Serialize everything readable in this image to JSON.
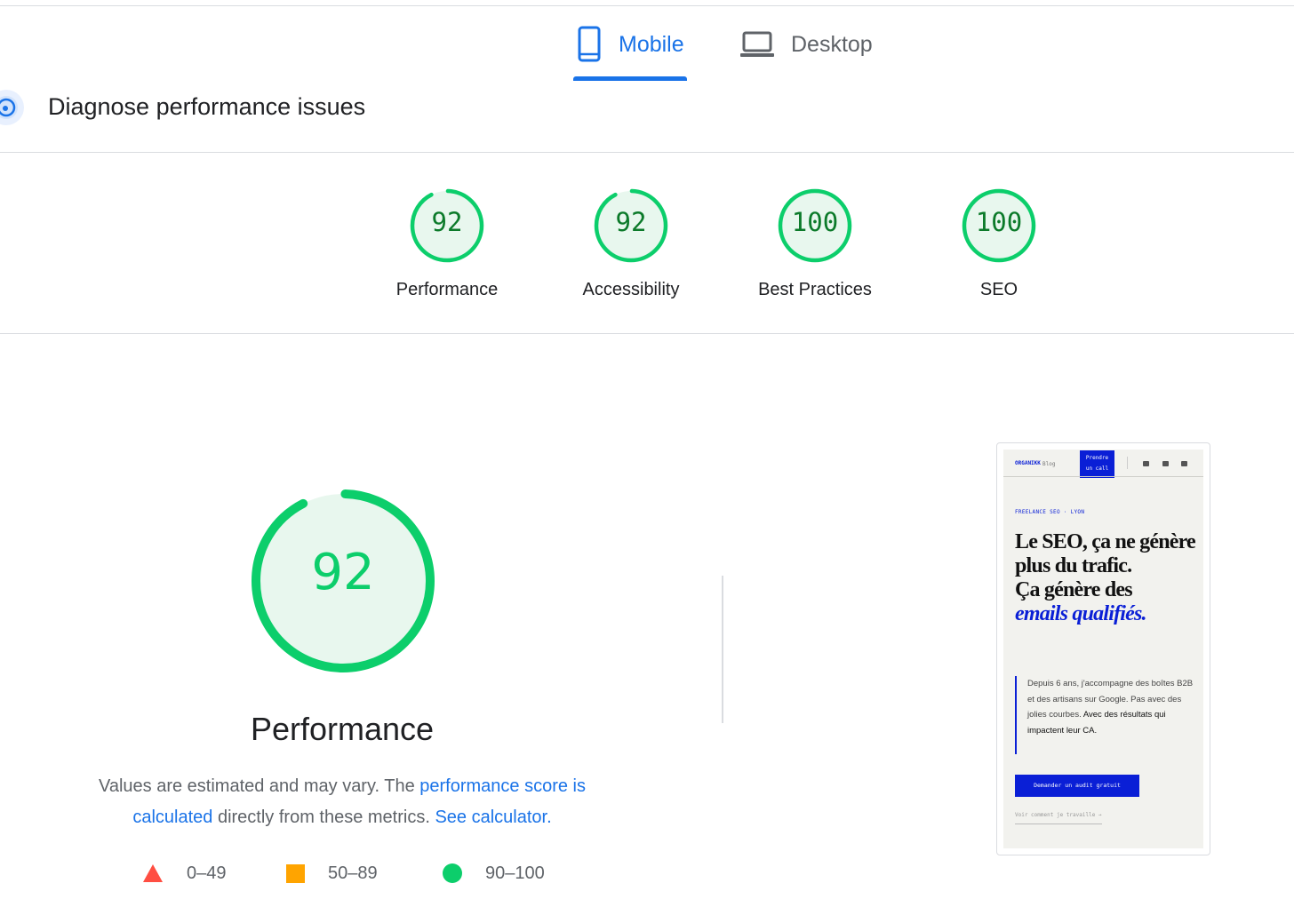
{
  "tabs": [
    {
      "label": "Mobile",
      "icon": "smartphone-icon",
      "active": true
    },
    {
      "label": "Desktop",
      "icon": "laptop-icon",
      "active": false
    }
  ],
  "diagnose": {
    "title": "Diagnose performance issues",
    "icon": "speedometer-icon"
  },
  "scores": [
    {
      "label": "Performance",
      "value": "92"
    },
    {
      "label": "Accessibility",
      "value": "92"
    },
    {
      "label": "Best Practices",
      "value": "100"
    },
    {
      "label": "SEO",
      "value": "100"
    }
  ],
  "performance": {
    "score": "92",
    "title": "Performance",
    "desc_part1": "Values are estimated and may vary. The ",
    "desc_link1": "performance score is calculated",
    "desc_part2": " directly from these metrics. ",
    "desc_link2": "See calculator."
  },
  "legend": [
    {
      "range": "0–49",
      "shape": "triangle",
      "color": "#ff4e42"
    },
    {
      "range": "50–89",
      "shape": "square",
      "color": "#ffa400"
    },
    {
      "range": "90–100",
      "shape": "circle",
      "color": "#0cce6b"
    }
  ],
  "colors": {
    "accent": "#1a73e8",
    "pass": "#0cce6b",
    "pass_text": "#0c7a2a",
    "pass_bg": "#e8f7ee"
  },
  "preview": {
    "brand": "ORGANIKK",
    "blog": "Blog",
    "cta_line1": "Prendre",
    "cta_line2": "un call",
    "kicker": "FREELANCE SEO · LYON",
    "headline_1": "Le SEO, ça ne génère plus du trafic.",
    "headline_2": "Ça génère des",
    "headline_em": "emails qualifiés.",
    "body_1": "Depuis 6 ans, j'accompagne des boîtes B2B et des artisans sur Google. Pas avec des jolies courbes.",
    "body_2": "Avec des résultats qui impactent leur CA.",
    "button": "Demander un audit gratuit",
    "link": "Voir comment je travaille →"
  }
}
